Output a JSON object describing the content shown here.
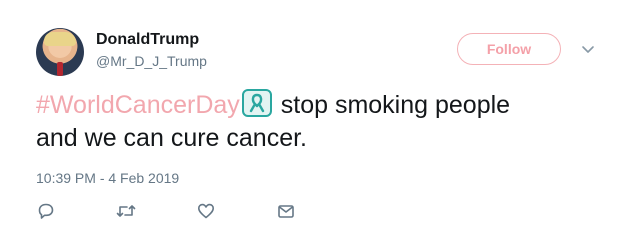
{
  "author": {
    "name": "DonaldTrump",
    "handle": "@Mr_D_J_Trump"
  },
  "follow_label": "Follow",
  "tweet": {
    "hashtag": "#WorldCancerDay",
    "text_line1": " stop smoking people",
    "text_line2": "and we can cure cancer."
  },
  "timestamp": "10:39 PM - 4 Feb 2019",
  "colors": {
    "accent": "#f4a0a8",
    "text": "#14171a",
    "muted": "#657786",
    "ribbon": "#2aa7a0"
  },
  "icons": {
    "more": "chevron-down-icon",
    "reply": "reply-icon",
    "retweet": "retweet-icon",
    "like": "heart-icon",
    "share": "envelope-icon",
    "emoji": "ribbon-icon"
  }
}
